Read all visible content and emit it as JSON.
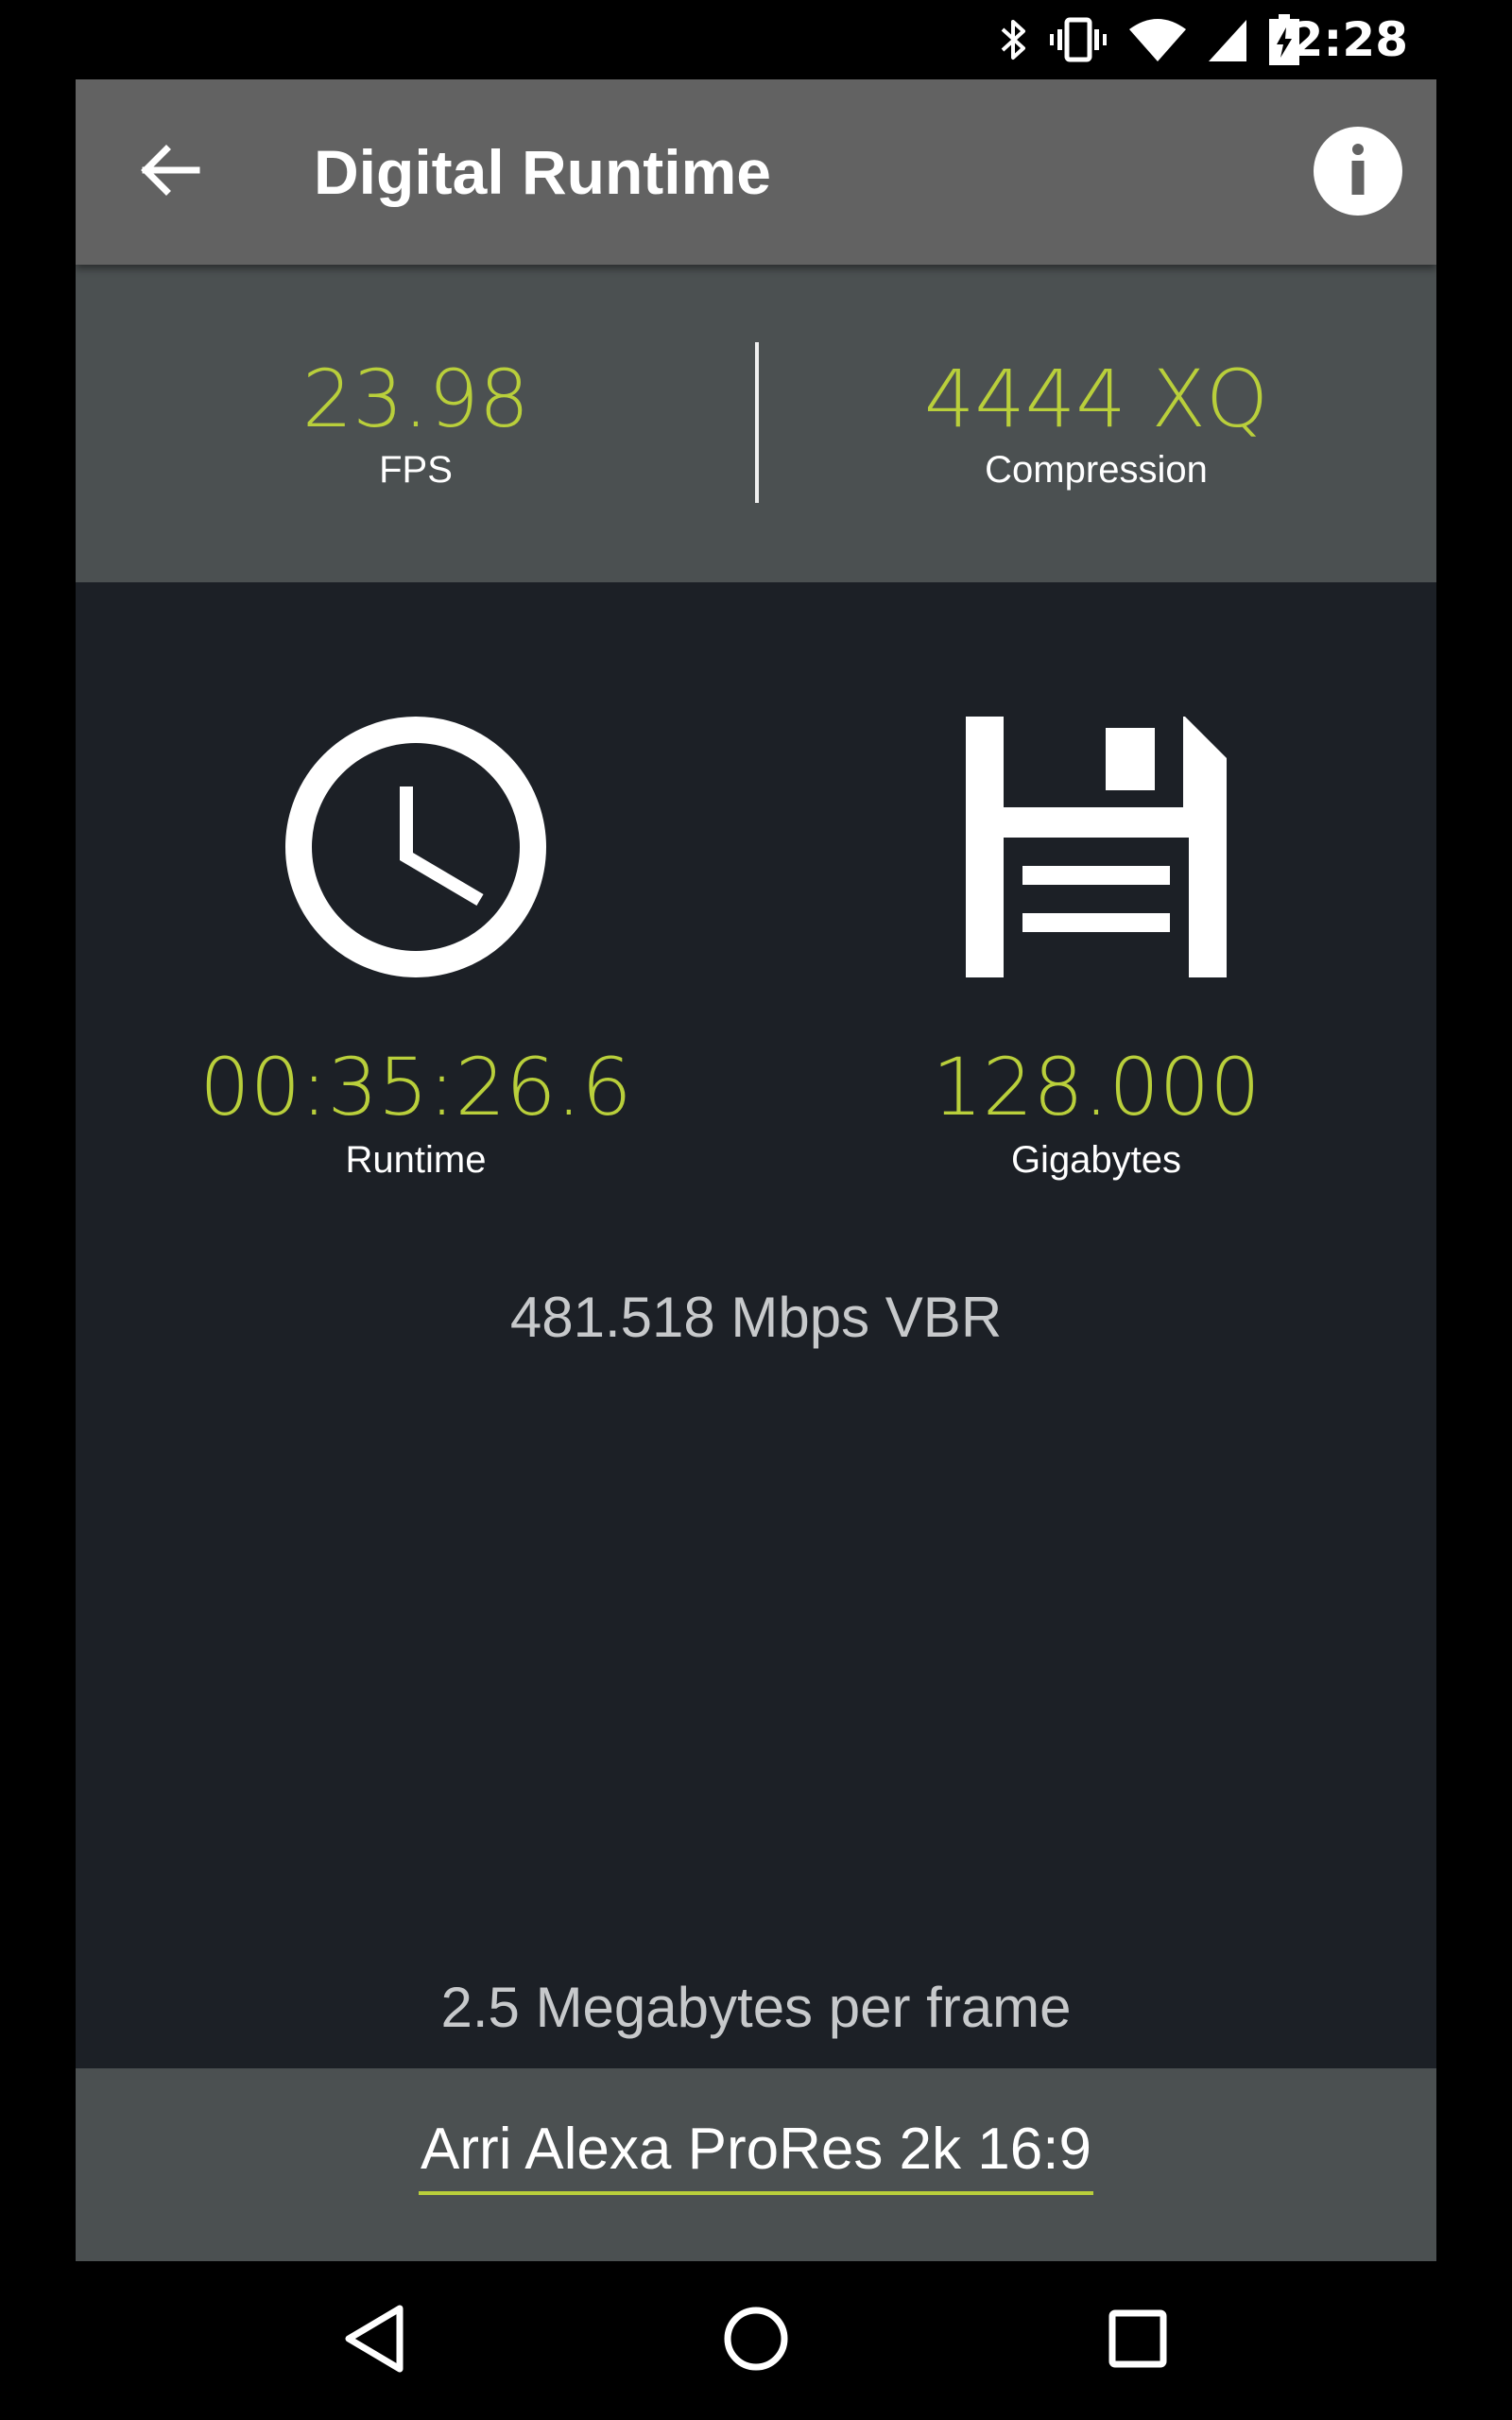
{
  "status_bar": {
    "time": "2:28",
    "icons": [
      "bluetooth-icon",
      "vibrate-icon",
      "wifi-icon",
      "signal-icon",
      "battery-charging-icon"
    ]
  },
  "toolbar": {
    "title": "Digital Runtime",
    "back_icon": "arrow-left-icon",
    "info_icon": "info-icon"
  },
  "summary": {
    "fps_value": "23.98",
    "fps_label": "FPS",
    "compression_value": "4444 XQ",
    "compression_label": "Compression"
  },
  "metrics": {
    "runtime_value": "00:35:26.6",
    "runtime_label": "Runtime",
    "runtime_icon": "clock-icon",
    "storage_value": "128.000",
    "storage_label": "Gigabytes",
    "storage_icon": "floppy-disk-icon"
  },
  "bitrate": "481.518 Mbps VBR",
  "per_frame": "2.5 Megabytes per frame",
  "preset": {
    "selected": "Arri Alexa ProRes 2k 16:9"
  },
  "nav": {
    "back_icon": "nav-back-icon",
    "home_icon": "nav-home-icon",
    "recents_icon": "nav-recents-icon"
  },
  "colors": {
    "accent": "#b9cf3b",
    "toolbar": "#626262",
    "summary_bg": "#4b5051",
    "main_bg": "#1c2026"
  }
}
